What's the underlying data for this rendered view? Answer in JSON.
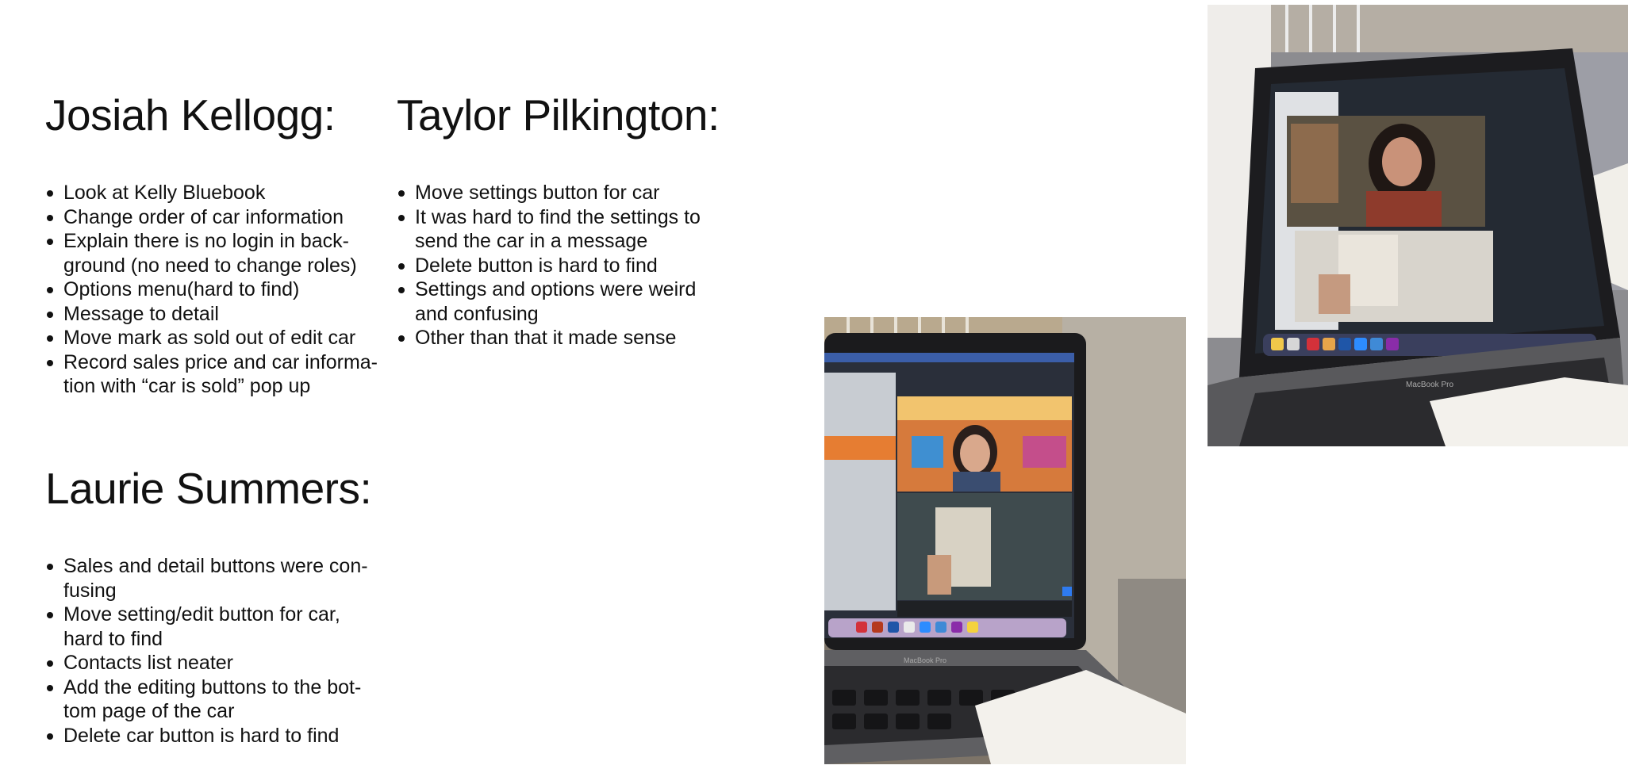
{
  "sections": {
    "josiah": {
      "name": "Josiah Kellogg:",
      "items": [
        "Look at Kelly Bluebook",
        "Change order of car information",
        "Explain there is no login in back-ground (no need to change roles)",
        "Options menu(hard to find)",
        "Message to detail",
        "Move mark as sold out of edit car",
        "Record sales price and car informa-tion with “car is sold” pop up"
      ]
    },
    "taylor": {
      "name": "Taylor Pilkington:",
      "items": [
        "Move settings button for car",
        "It was hard to find the settings to send the car in a message",
        "Delete button is hard to find",
        "Settings and options were weird and confusing",
        "Other than that it made sense"
      ]
    },
    "laurie": {
      "name": "Laurie Summers:",
      "items": [
        "Sales and detail buttons were con-fusing",
        "Move setting/edit button for car, hard to find",
        "Contacts list neater",
        "Add the editing buttons to the bot-tom page of the car",
        "Delete car button is hard to find"
      ]
    }
  },
  "photos": {
    "photo1": {
      "laptop_label": "MacBook Pro",
      "participant": "Taylor Pilkington"
    },
    "photo2": {
      "laptop_label": "MacBook Pro",
      "participant": "Laurie Summers"
    }
  }
}
